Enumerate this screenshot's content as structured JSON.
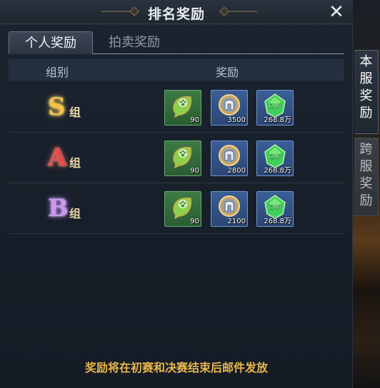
{
  "title": "排名奖励",
  "tabs": [
    {
      "label": "个人奖励",
      "active": true
    },
    {
      "label": "拍卖奖励",
      "active": false
    }
  ],
  "side_tabs": [
    {
      "chars": [
        "本",
        "服",
        "奖",
        "励"
      ],
      "active": true
    },
    {
      "chars": [
        "跨",
        "服",
        "奖",
        "励"
      ],
      "active": false
    }
  ],
  "header": {
    "group": "组别",
    "reward": "奖励"
  },
  "rows": [
    {
      "grade": "S",
      "suffix": "组",
      "rewards": [
        {
          "icon": "paw-leaf-icon",
          "qty": "90"
        },
        {
          "icon": "helmet-coin-icon",
          "qty": "3500"
        },
        {
          "icon": "exp-gem-icon",
          "qty": "268.8万"
        }
      ]
    },
    {
      "grade": "A",
      "suffix": "组",
      "rewards": [
        {
          "icon": "paw-leaf-icon",
          "qty": "90"
        },
        {
          "icon": "helmet-coin-icon",
          "qty": "2800"
        },
        {
          "icon": "exp-gem-icon",
          "qty": "268.8万"
        }
      ]
    },
    {
      "grade": "B",
      "suffix": "组",
      "rewards": [
        {
          "icon": "paw-leaf-icon",
          "qty": "90"
        },
        {
          "icon": "helmet-coin-icon",
          "qty": "2100"
        },
        {
          "icon": "exp-gem-icon",
          "qty": "268.8万"
        }
      ]
    }
  ],
  "footer": "奖励将在初赛和决赛结束后邮件发放",
  "exp_label": "EXP",
  "colors": {
    "accent_gold": "#e8b64a",
    "grade_s": "#f3c24a",
    "grade_a": "#e84a4a",
    "grade_b": "#c79ae8"
  }
}
